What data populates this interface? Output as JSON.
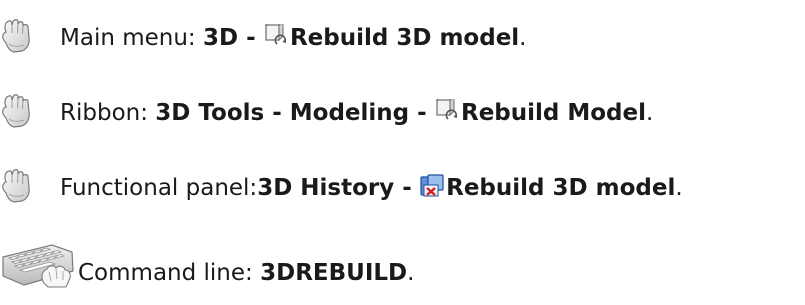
{
  "items": [
    {
      "icon": "pointing-hand-icon",
      "label": "Main menu:",
      "path": "3D -",
      "action_icon": "rebuild-icon",
      "action": "Rebuild 3D model",
      "end": "."
    },
    {
      "icon": "pointing-hand-icon",
      "label": "Ribbon:",
      "path": "3D Tools - Modeling -",
      "action_icon": "rebuild-icon",
      "action": "Rebuild Model",
      "end": "."
    },
    {
      "icon": "pointing-hand-icon",
      "label": "Functional panel:",
      "path": "3D History -",
      "action_icon": "rebuild-3d-model-icon",
      "action": "Rebuild 3D model",
      "end": "."
    },
    {
      "icon": "keyboard-icon",
      "label": "Command line:",
      "command": "3DREBUILD",
      "end": "."
    }
  ]
}
